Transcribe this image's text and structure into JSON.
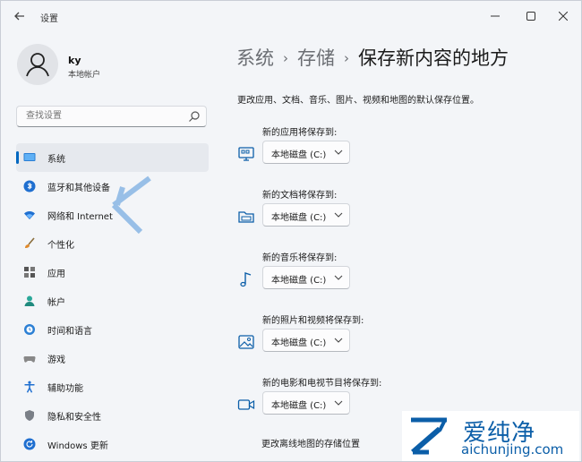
{
  "window": {
    "title": "设置"
  },
  "profile": {
    "name": "ky",
    "account_type": "本地帐户"
  },
  "search": {
    "placeholder": "查找设置"
  },
  "nav": {
    "items": [
      {
        "label": "系统",
        "icon": "monitor-icon",
        "active": true
      },
      {
        "label": "蓝牙和其他设备",
        "icon": "bluetooth-icon"
      },
      {
        "label": "网络和 Internet",
        "icon": "wifi-icon"
      },
      {
        "label": "个性化",
        "icon": "brush-icon"
      },
      {
        "label": "应用",
        "icon": "apps-icon"
      },
      {
        "label": "帐户",
        "icon": "person-icon"
      },
      {
        "label": "时间和语言",
        "icon": "globe-clock-icon"
      },
      {
        "label": "游戏",
        "icon": "gamepad-icon"
      },
      {
        "label": "辅助功能",
        "icon": "accessibility-icon"
      },
      {
        "label": "隐私和安全性",
        "icon": "shield-icon"
      },
      {
        "label": "Windows 更新",
        "icon": "update-icon"
      }
    ]
  },
  "breadcrumb": {
    "items": [
      "系统",
      "存储"
    ],
    "separator": "›",
    "current": "保存新内容的地方"
  },
  "description": "更改应用、文档、音乐、图片、视频和地图的默认保存位置。",
  "groups": [
    {
      "label": "新的应用将保存到:",
      "value": "本地磁盘 (C:)",
      "icon": "app-window-icon"
    },
    {
      "label": "新的文档将保存到:",
      "value": "本地磁盘 (C:)",
      "icon": "folder-icon"
    },
    {
      "label": "新的音乐将保存到:",
      "value": "本地磁盘 (C:)",
      "icon": "music-note-icon"
    },
    {
      "label": "新的照片和视频将保存到:",
      "value": "本地磁盘 (C:)",
      "icon": "image-icon"
    },
    {
      "label": "新的电影和电视节目将保存到:",
      "value": "本地磁盘 (C:)",
      "icon": "video-icon"
    }
  ],
  "offline_maps": {
    "label": "更改离线地图的存储位置"
  },
  "watermark": {
    "brand": "爱纯净",
    "site": "aichunjing.com"
  },
  "colors": {
    "accent": "#0067c0",
    "brand_blue": "#0b5ea8",
    "background": "#f3f5f8"
  }
}
